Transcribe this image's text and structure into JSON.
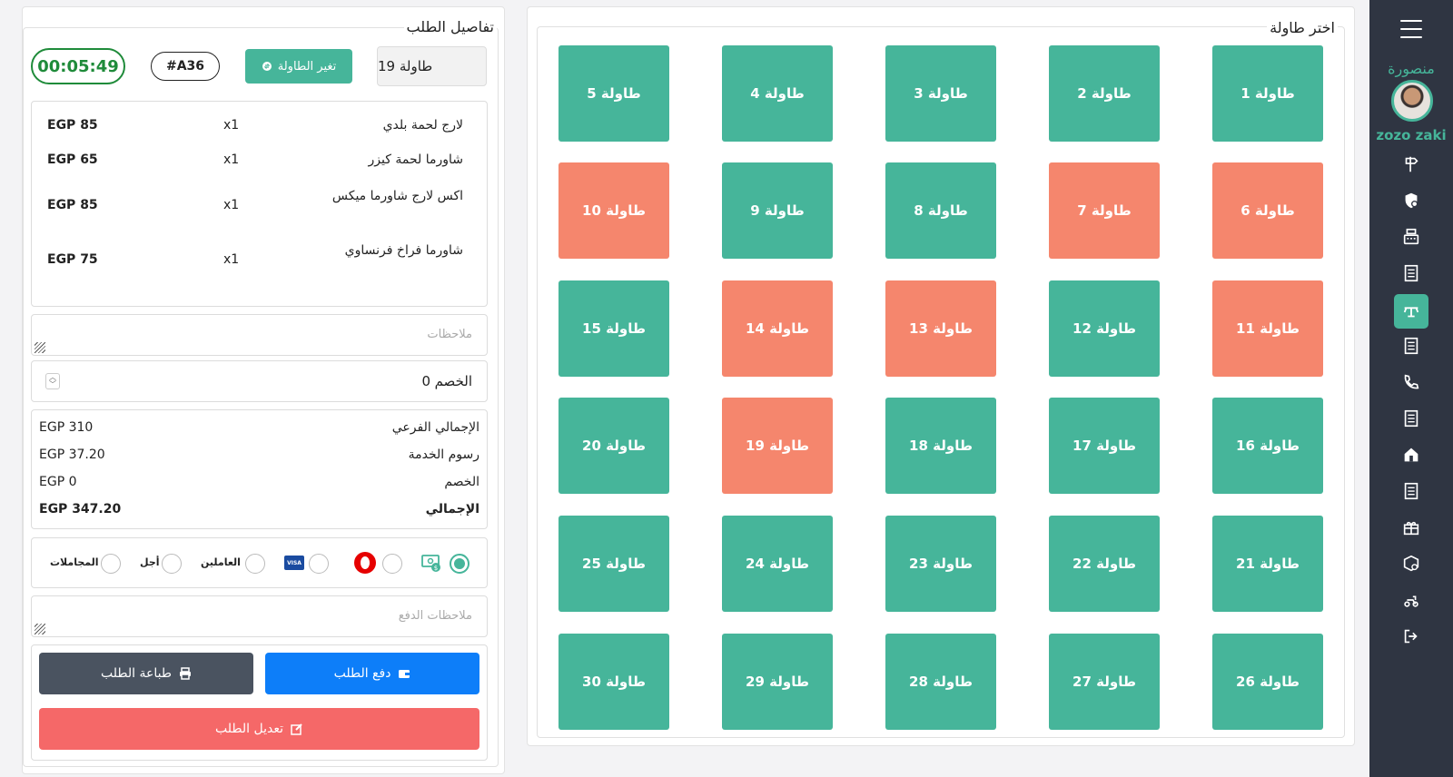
{
  "sidebar": {
    "branch": "منصورة",
    "username": "zozo zaki",
    "icons": [
      "signpost-icon",
      "shield-coin-icon",
      "cash-register-icon",
      "receipt-icon",
      "dining-table-icon",
      "receipt-icon",
      "phone-icon",
      "receipt-icon",
      "home-icon",
      "receipt-icon",
      "gift-icon",
      "package-search-icon",
      "delivery-scooter-icon",
      "logout-icon"
    ],
    "active_index": 4,
    "active_color": "#46b59a"
  },
  "tables_panel": {
    "legend": "اختر طاولة",
    "tables": [
      {
        "label": "طاولة 1",
        "status": "free"
      },
      {
        "label": "طاولة 2",
        "status": "free"
      },
      {
        "label": "طاولة 3",
        "status": "free"
      },
      {
        "label": "طاولة 4",
        "status": "free"
      },
      {
        "label": "طاولة 5",
        "status": "free"
      },
      {
        "label": "طاولة 6",
        "status": "busy"
      },
      {
        "label": "طاولة 7",
        "status": "busy"
      },
      {
        "label": "طاولة 8",
        "status": "free"
      },
      {
        "label": "طاولة 9",
        "status": "free"
      },
      {
        "label": "طاولة 10",
        "status": "busy"
      },
      {
        "label": "طاولة 11",
        "status": "busy"
      },
      {
        "label": "طاولة 12",
        "status": "free"
      },
      {
        "label": "طاولة 13",
        "status": "busy"
      },
      {
        "label": "طاولة 14",
        "status": "busy"
      },
      {
        "label": "طاولة 15",
        "status": "free"
      },
      {
        "label": "طاولة 16",
        "status": "free"
      },
      {
        "label": "طاولة 17",
        "status": "free"
      },
      {
        "label": "طاولة 18",
        "status": "free"
      },
      {
        "label": "طاولة 19",
        "status": "busy"
      },
      {
        "label": "طاولة 20",
        "status": "free"
      },
      {
        "label": "طاولة 21",
        "status": "free"
      },
      {
        "label": "طاولة 22",
        "status": "free"
      },
      {
        "label": "طاولة 23",
        "status": "free"
      },
      {
        "label": "طاولة 24",
        "status": "free"
      },
      {
        "label": "طاولة 25",
        "status": "free"
      },
      {
        "label": "طاولة 26",
        "status": "free"
      },
      {
        "label": "طاولة 27",
        "status": "free"
      },
      {
        "label": "طاولة 28",
        "status": "free"
      },
      {
        "label": "طاولة 29",
        "status": "free"
      },
      {
        "label": "طاولة 30",
        "status": "free"
      }
    ],
    "colors": {
      "free": "#46b59a",
      "busy": "#f5866d"
    }
  },
  "order_panel": {
    "legend": "تفاصيل الطلب",
    "selected_table": "طاولة 19",
    "change_table_label": "تغير الطاولة",
    "order_number": "#A36",
    "timer": "00:05:49",
    "items": [
      {
        "name": "لارج لحمة بلدي",
        "qty": "x1",
        "price": "EGP 85"
      },
      {
        "name": "شاورما لحمة كيزر",
        "qty": "x1",
        "price": "EGP 65"
      },
      {
        "name": "اكس لارج شاورما ميكس",
        "qty": "x1",
        "price": "EGP 85"
      },
      {
        "name": "شاورما فراخ فرنساوي",
        "qty": "x1",
        "price": "EGP 75"
      }
    ],
    "notes_placeholder": "ملاحظات",
    "discount_label": "الخصم",
    "discount_value": "0",
    "totals": {
      "subtotal_label": "الإجمالي الفرعي",
      "subtotal_value": "EGP 310",
      "service_label": "رسوم الخدمة",
      "service_value": "EGP 37.20",
      "discount_label": "الخصم",
      "discount_value": "EGP 0",
      "total_label": "الإجمالي",
      "total_value": "EGP 347.20"
    },
    "payment_methods": {
      "selected": "cash",
      "staff_label": "العاملين",
      "deferred_label": "أجل",
      "complimentary_label": "المجاملات",
      "visa_text": "VISA"
    },
    "payment_notes_placeholder": "ملاحظات الدفع",
    "pay_button": "دفع الطلب",
    "print_button": "طباعة الطلب",
    "edit_button": "تعديل الطلب"
  }
}
